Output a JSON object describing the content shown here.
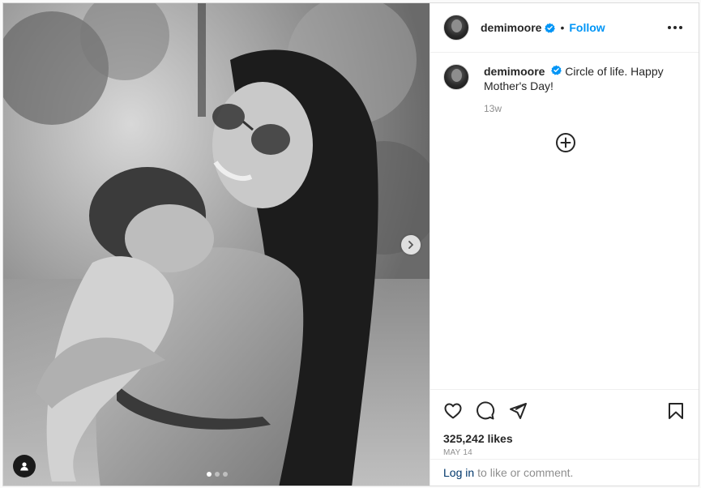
{
  "post": {
    "author": "demimoore",
    "follow_label": "Follow",
    "bullet": "•",
    "caption": "Circle of life. Happy Mother's Day!",
    "caption_time": "13w",
    "likes": "325,242 likes",
    "date": "MAY 14",
    "login_link": "Log in",
    "login_text": "to like or comment."
  },
  "carousel": {
    "total": 3,
    "active": 1
  },
  "icons": {
    "verified": "verified-badge-icon",
    "more": "more-options-icon",
    "load_more": "plus-circle-icon",
    "like": "heart-icon",
    "comment": "comment-icon",
    "share": "send-icon",
    "save": "bookmark-icon",
    "next": "chevron-right-icon",
    "tags": "user-tag-icon"
  },
  "colors": {
    "accent": "#0095f6",
    "link": "#00376b",
    "muted": "#8e8e8e",
    "text": "#262626"
  }
}
